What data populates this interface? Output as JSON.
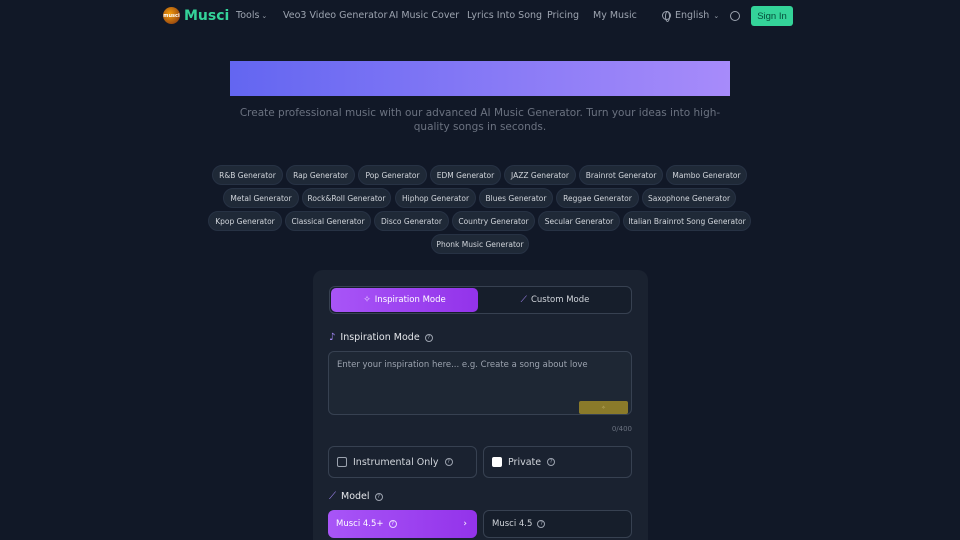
{
  "header": {
    "logo_badge": "musci",
    "logo_text": "Musci",
    "nav": [
      {
        "label": "Tools"
      },
      {
        "label": "Veo3 Video Generator"
      },
      {
        "label": "AI Music Cover"
      },
      {
        "label": "Lyrics Into Song"
      },
      {
        "label": "Pricing"
      },
      {
        "label": "My Music"
      }
    ],
    "language": "English",
    "signin_label": "Sign In"
  },
  "hero": {
    "subtitle": "Create professional music with our advanced AI Music Generator. Turn your ideas into high-quality songs in seconds."
  },
  "genres": [
    "R&B Generator",
    "Rap Generator",
    "Pop Generator",
    "EDM Generator",
    "JAZZ Generator",
    "Brainrot Generator",
    "Mambo Generator",
    "Metal Generator",
    "Rock&Roll Generator",
    "Hiphop Generator",
    "Blues Generator",
    "Reggae Generator",
    "Saxophone Generator",
    "Kpop Generator",
    "Classical Generator",
    "Disco Generator",
    "Country Generator",
    "Secular Generator",
    "Italian Brainrot Song Generator",
    "Phonk Music Generator"
  ],
  "form": {
    "modes": {
      "inspiration": "Inspiration Mode",
      "custom": "Custom Mode"
    },
    "section_label": "Inspiration Mode",
    "placeholder": "Enter your inspiration here... e.g. Create a song about love",
    "counter": "0/400",
    "instrumental_label": "Instrumental Only",
    "private_label": "Private",
    "model_label": "Model",
    "models": {
      "active": "Musci 4.5+",
      "other": "Musci 4.5"
    }
  },
  "colors": {
    "background": "#111827",
    "accent_green": "#34d399",
    "accent_purple": "#a855f7"
  },
  "icons": {
    "mode_inspiration": "sparkles-icon",
    "mode_custom": "magic-wand-icon",
    "section": "music-note-icon",
    "help": "question-circle-icon",
    "language": "globe-icon",
    "theme": "sun-icon"
  }
}
